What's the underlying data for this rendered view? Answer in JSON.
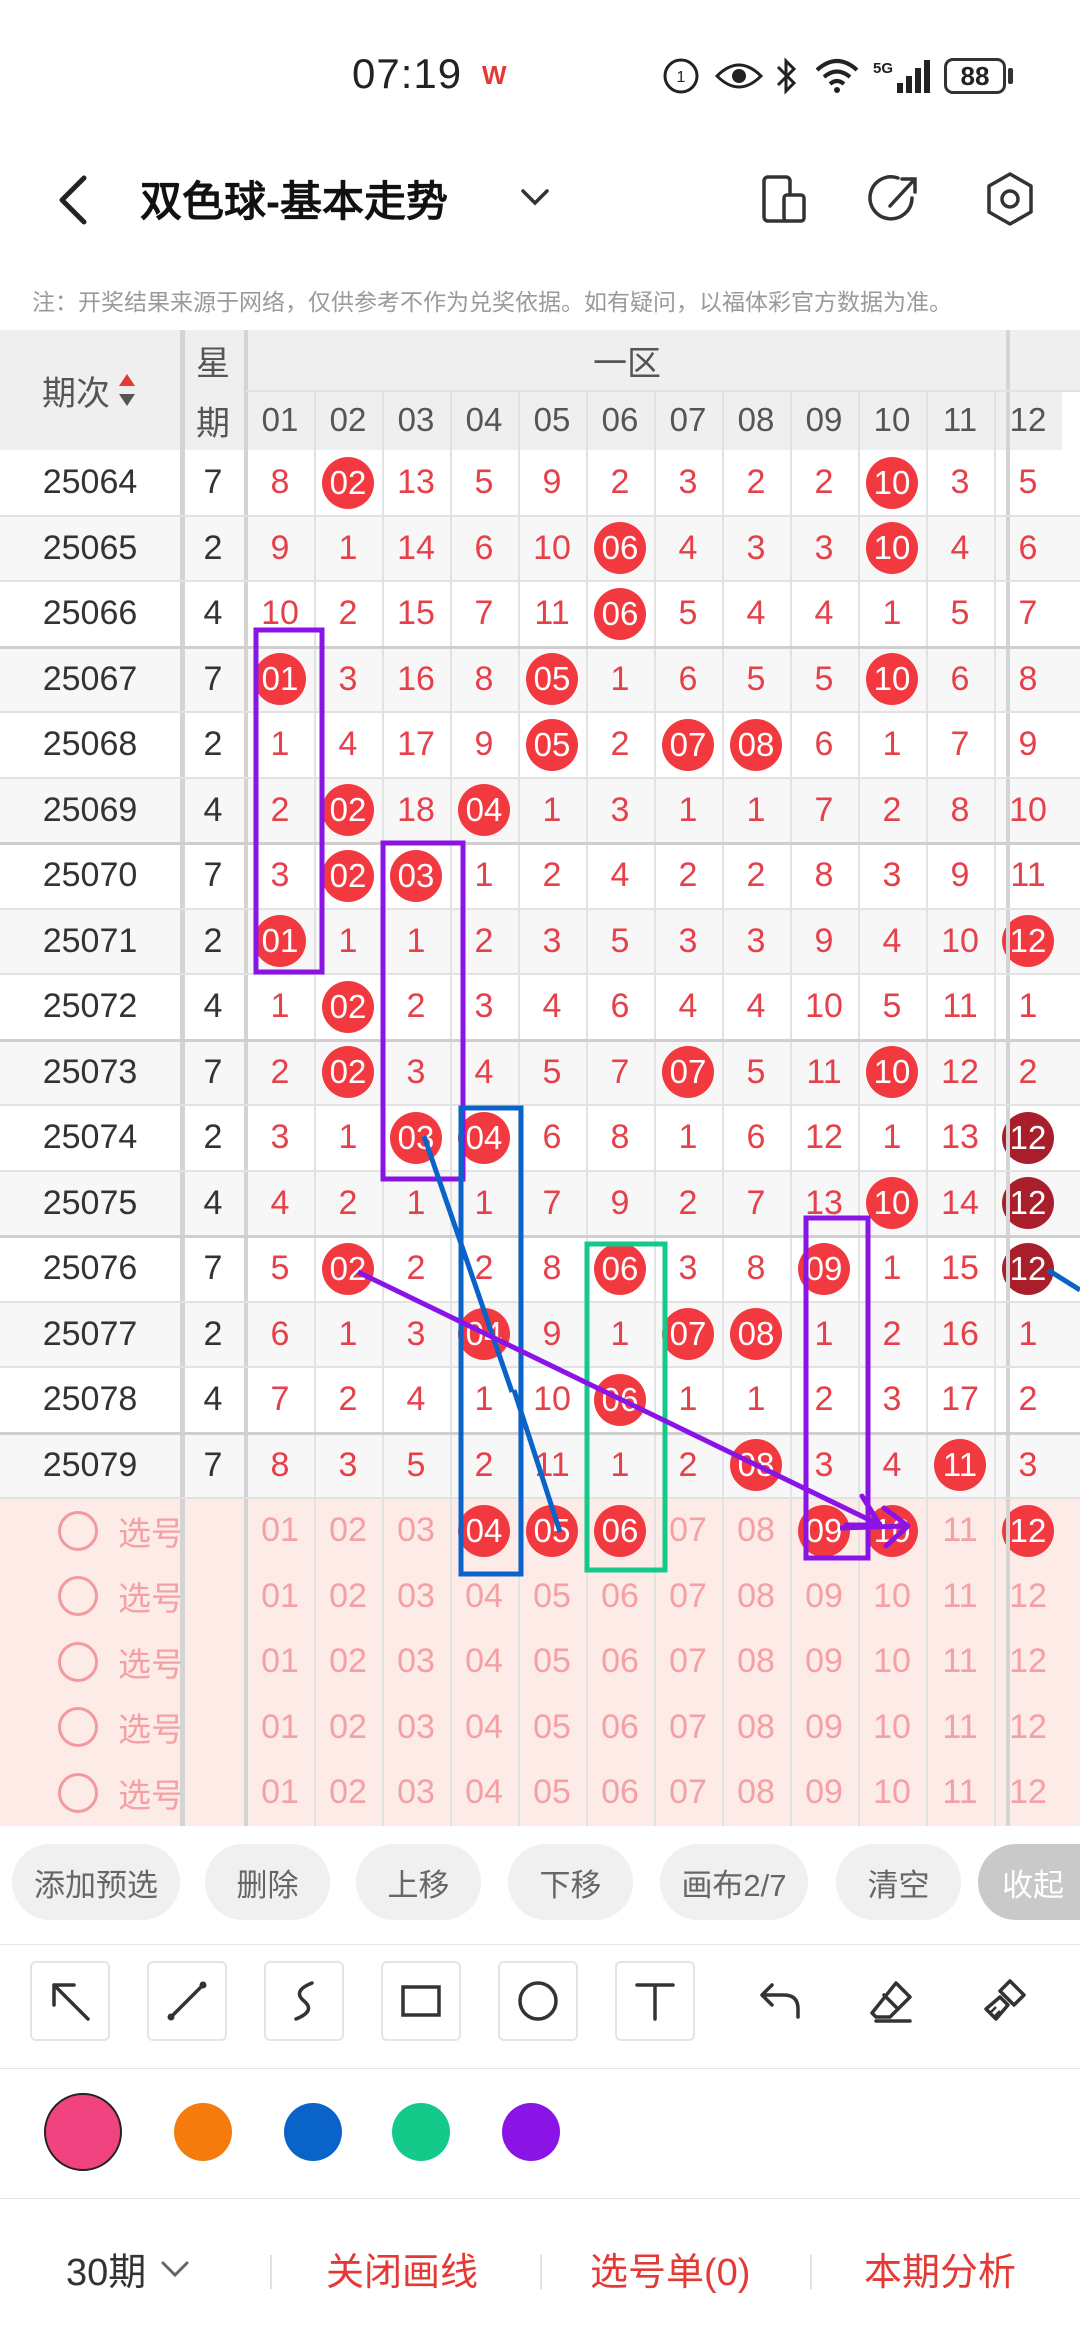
{
  "status_bar": {
    "time": "07:19",
    "battery": "88",
    "icons": [
      "wps-icon",
      "hd-call-icon",
      "eye-icon",
      "bluetooth-icon",
      "wifi-icon",
      "5g-signal-icon",
      "battery-icon"
    ]
  },
  "header": {
    "title": "双色球-基本走势",
    "icons": [
      "back-arrow-icon",
      "chevron-down-icon",
      "device-layout-icon",
      "share-icon",
      "settings-icon"
    ]
  },
  "notice": "注：开奖结果来源于网络，仅供参考不作为兑奖依据。如有疑问，以福体彩官方数据为准。",
  "table": {
    "period_header": "期次",
    "weekday_header_top": "星",
    "weekday_header_bottom": "期",
    "zone_header": "一区",
    "columns": [
      "01",
      "02",
      "03",
      "04",
      "05",
      "06",
      "07",
      "08",
      "09",
      "10",
      "11",
      "12"
    ],
    "rows": [
      {
        "period": "25064",
        "weekday": "7",
        "cells": [
          "8",
          "02",
          "13",
          "5",
          "9",
          "2",
          "3",
          "2",
          "2",
          "10",
          "3",
          "5"
        ]
      },
      {
        "period": "25065",
        "weekday": "2",
        "cells": [
          "9",
          "1",
          "14",
          "6",
          "10",
          "06",
          "4",
          "3",
          "3",
          "10",
          "4",
          "6"
        ]
      },
      {
        "period": "25066",
        "weekday": "4",
        "cells": [
          "10",
          "2",
          "15",
          "7",
          "11",
          "06",
          "5",
          "4",
          "4",
          "1",
          "5",
          "7"
        ]
      },
      {
        "period": "25067",
        "weekday": "7",
        "cells": [
          "01",
          "3",
          "16",
          "8",
          "05",
          "1",
          "6",
          "5",
          "5",
          "10",
          "6",
          "8"
        ]
      },
      {
        "period": "25068",
        "weekday": "2",
        "cells": [
          "1",
          "4",
          "17",
          "9",
          "05",
          "2",
          "07",
          "08",
          "6",
          "1",
          "7",
          "9"
        ]
      },
      {
        "period": "25069",
        "weekday": "4",
        "cells": [
          "2",
          "02",
          "18",
          "04",
          "1",
          "3",
          "1",
          "1",
          "7",
          "2",
          "8",
          "10"
        ]
      },
      {
        "period": "25070",
        "weekday": "7",
        "cells": [
          "3",
          "02",
          "03",
          "1",
          "2",
          "4",
          "2",
          "2",
          "8",
          "3",
          "9",
          "11"
        ]
      },
      {
        "period": "25071",
        "weekday": "2",
        "cells": [
          "01",
          "1",
          "1",
          "2",
          "3",
          "5",
          "3",
          "3",
          "9",
          "4",
          "10",
          "12"
        ]
      },
      {
        "period": "25072",
        "weekday": "4",
        "cells": [
          "1",
          "02",
          "2",
          "3",
          "4",
          "6",
          "4",
          "4",
          "10",
          "5",
          "11",
          "1"
        ]
      },
      {
        "period": "25073",
        "weekday": "7",
        "cells": [
          "2",
          "02",
          "3",
          "4",
          "5",
          "7",
          "07",
          "5",
          "11",
          "10",
          "12",
          "2"
        ]
      },
      {
        "period": "25074",
        "weekday": "2",
        "cells": [
          "3",
          "1",
          "03",
          "04",
          "6",
          "8",
          "1",
          "6",
          "12",
          "1",
          "13",
          "12"
        ]
      },
      {
        "period": "25075",
        "weekday": "4",
        "cells": [
          "4",
          "2",
          "1",
          "1",
          "7",
          "9",
          "2",
          "7",
          "13",
          "10",
          "14",
          "12"
        ]
      },
      {
        "period": "25076",
        "weekday": "7",
        "cells": [
          "5",
          "02",
          "2",
          "2",
          "8",
          "06",
          "3",
          "8",
          "09",
          "1",
          "15",
          "12"
        ]
      },
      {
        "period": "25077",
        "weekday": "2",
        "cells": [
          "6",
          "1",
          "3",
          "04",
          "9",
          "1",
          "07",
          "08",
          "1",
          "2",
          "16",
          "1"
        ]
      },
      {
        "period": "25078",
        "weekday": "4",
        "cells": [
          "7",
          "2",
          "4",
          "1",
          "10",
          "06",
          "1",
          "1",
          "2",
          "3",
          "17",
          "2"
        ]
      },
      {
        "period": "25079",
        "weekday": "7",
        "cells": [
          "8",
          "3",
          "5",
          "2",
          "11",
          "1",
          "2",
          "08",
          "3",
          "4",
          "11",
          "3"
        ]
      }
    ],
    "hits": [
      [
        false,
        true,
        false,
        false,
        false,
        false,
        false,
        false,
        false,
        true,
        false,
        false
      ],
      [
        false,
        false,
        false,
        false,
        false,
        true,
        false,
        false,
        false,
        true,
        false,
        false
      ],
      [
        false,
        false,
        false,
        false,
        false,
        true,
        false,
        false,
        false,
        false,
        false,
        false
      ],
      [
        true,
        false,
        false,
        false,
        true,
        false,
        false,
        false,
        false,
        true,
        false,
        false
      ],
      [
        false,
        false,
        false,
        false,
        true,
        false,
        true,
        true,
        false,
        false,
        false,
        false
      ],
      [
        false,
        true,
        false,
        true,
        false,
        false,
        false,
        false,
        false,
        false,
        false,
        false
      ],
      [
        false,
        true,
        true,
        false,
        false,
        false,
        false,
        false,
        false,
        false,
        false,
        false
      ],
      [
        true,
        false,
        false,
        false,
        false,
        false,
        false,
        false,
        false,
        false,
        false,
        true
      ],
      [
        false,
        true,
        false,
        false,
        false,
        false,
        false,
        false,
        false,
        false,
        false,
        false
      ],
      [
        false,
        true,
        false,
        false,
        false,
        false,
        true,
        false,
        false,
        true,
        false,
        false
      ],
      [
        false,
        false,
        true,
        true,
        false,
        false,
        false,
        false,
        false,
        false,
        false,
        true
      ],
      [
        false,
        false,
        false,
        false,
        false,
        false,
        false,
        false,
        false,
        true,
        false,
        true
      ],
      [
        false,
        true,
        false,
        false,
        false,
        true,
        false,
        false,
        true,
        false,
        false,
        true
      ],
      [
        false,
        false,
        false,
        true,
        false,
        false,
        true,
        true,
        false,
        false,
        false,
        false
      ],
      [
        false,
        false,
        false,
        false,
        false,
        true,
        false,
        false,
        false,
        false,
        false,
        false
      ],
      [
        false,
        false,
        false,
        false,
        false,
        false,
        false,
        true,
        false,
        false,
        true,
        false
      ]
    ],
    "pick_label": "选号",
    "pick_rows": 5,
    "pick_selected": [
      false,
      false,
      false,
      true,
      true,
      true,
      false,
      false,
      true,
      true,
      false,
      true
    ]
  },
  "actions": [
    "添加预选",
    "删除",
    "上移",
    "下移",
    "画布2/7",
    "清空",
    "收起"
  ],
  "tools": [
    "select-arrow-icon",
    "line-icon",
    "curve-icon",
    "rectangle-icon",
    "circle-icon",
    "text-icon",
    "undo-icon",
    "eraser-icon",
    "clear-brush-icon"
  ],
  "palette": {
    "colors": [
      "#f0437f",
      "#f57c0c",
      "#0a63c9",
      "#14c98a",
      "#8a14e6"
    ],
    "selected": 0
  },
  "bottom": {
    "periods": "30期",
    "close_lines": "关闭画线",
    "pick_list": "选号单(0)",
    "analysis": "本期分析"
  }
}
